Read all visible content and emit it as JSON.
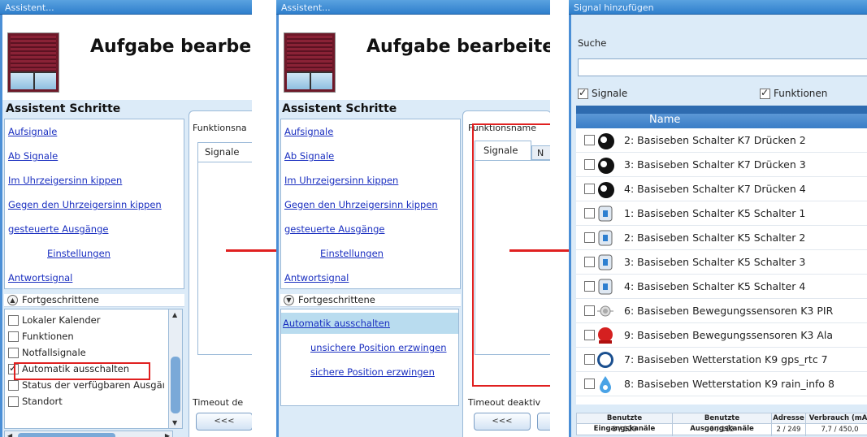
{
  "panel1": {
    "titlebar": "Assistent...",
    "header_title": "Aufgabe bearbei",
    "steps_title": "Assistent Schritte",
    "steps": [
      "Aufsignale",
      "Ab Signale",
      "Im Uhrzeigersinn kippen",
      "Gegen den Uhrzeigersinn kippen",
      "gesteuerte Ausgänge",
      "Einstellungen",
      "Antwortsignal"
    ],
    "advanced_label": "Fortgeschrittene",
    "advanced_items": [
      {
        "label": "Lokaler Kalender",
        "checked": false
      },
      {
        "label": "Funktionen",
        "checked": false
      },
      {
        "label": "Notfallsignale",
        "checked": false
      },
      {
        "label": "Automatik ausschalten",
        "checked": true
      },
      {
        "label": "Status der verfügbaren Ausgäı",
        "checked": false
      },
      {
        "label": "Standort",
        "checked": false
      }
    ],
    "function_name_label": "Funktionsna",
    "tab_signals": "Signale",
    "timeout_label": "Timeout de",
    "prev_button": "<<<"
  },
  "panel2": {
    "titlebar": "Assistent...",
    "header_title": "Aufgabe bearbeite",
    "steps_title": "Assistent Schritte",
    "steps": [
      "Aufsignale",
      "Ab Signale",
      "Im Uhrzeigersinn kippen",
      "Gegen den Uhrzeigersinn kippen",
      "gesteuerte Ausgänge",
      "Einstellungen",
      "Antwortsignal"
    ],
    "advanced_label": "Fortgeschrittene",
    "advanced_items": [
      "Automatik ausschalten",
      "unsichere Position erzwingen",
      "sichere Position erzwingen"
    ],
    "function_name_label": "Funktionsname",
    "tab_signals": "Signale",
    "tab_partial": "N",
    "timeout_label": "Timeout deaktiv",
    "prev_button": "<<<"
  },
  "panel3": {
    "titlebar": "Signal hinzufügen",
    "search_label": "Suche",
    "search_value": "",
    "filter_signals": "Signale",
    "filter_functions": "Funktionen",
    "column_name": "Name",
    "rows": [
      {
        "label": "2: Basiseben Schalter K7 Drücken 2",
        "icon": "push-button-icon"
      },
      {
        "label": "3: Basiseben Schalter K7 Drücken 3",
        "icon": "push-button-icon"
      },
      {
        "label": "4: Basiseben Schalter K7 Drücken 4",
        "icon": "push-button-icon"
      },
      {
        "label": "1: Basiseben Schalter K5 Schalter 1",
        "icon": "switch-icon"
      },
      {
        "label": "2: Basiseben Schalter K5 Schalter 2",
        "icon": "switch-icon"
      },
      {
        "label": "3: Basiseben Schalter K5 Schalter 3",
        "icon": "switch-icon"
      },
      {
        "label": "4: Basiseben Schalter K5 Schalter 4",
        "icon": "switch-icon"
      },
      {
        "label": "6: Basiseben Bewegungssensoren K3 PIR",
        "icon": "motion-sensor-icon"
      },
      {
        "label": "9: Basiseben Bewegungssensoren K3 Ala",
        "icon": "alarm-icon"
      },
      {
        "label": "7: Basiseben Wetterstation K9 gps_rtc 7",
        "icon": "gps-icon"
      },
      {
        "label": "8: Basiseben Wetterstation K9 rain_info 8",
        "icon": "rain-icon"
      }
    ],
    "footer": {
      "headers": [
        "Benutzte Eingangskanäle",
        "Benutzte Ausgangskanäle",
        "Adresse",
        "Verbrauch (mA)"
      ],
      "values": [
        "3 / 120",
        "0 / 112",
        "2 / 249",
        "7,7 / 450,0"
      ]
    }
  },
  "colors": {
    "accent": "#3a7dc6",
    "highlight": "#e02020",
    "link": "#1a2fc0"
  }
}
